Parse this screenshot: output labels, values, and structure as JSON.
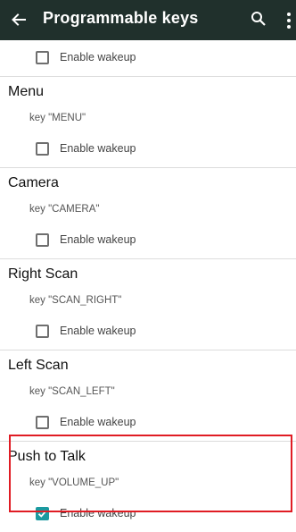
{
  "appbar": {
    "title": "Programmable keys",
    "icons": {
      "back": "arrow-back-icon",
      "search": "search-icon",
      "more": "more-vert-icon"
    }
  },
  "top_wakeup": {
    "label": "Enable wakeup",
    "checked": false
  },
  "sections": [
    {
      "title": "Menu",
      "key": "key \"MENU\"",
      "wakeup_label": "Enable wakeup",
      "checked": false
    },
    {
      "title": "Camera",
      "key": "key \"CAMERA\"",
      "wakeup_label": "Enable wakeup",
      "checked": false
    },
    {
      "title": "Right Scan",
      "key": "key \"SCAN_RIGHT\"",
      "wakeup_label": "Enable wakeup",
      "checked": false
    },
    {
      "title": "Left Scan",
      "key": "key \"SCAN_LEFT\"",
      "wakeup_label": "Enable wakeup",
      "checked": false
    },
    {
      "title": "Push to Talk",
      "key": "key \"VOLUME_UP\"",
      "wakeup_label": "Enable wakeup",
      "checked": true
    }
  ],
  "colors": {
    "appbar": "#20302c",
    "accent": "#1b9aa0",
    "highlight": "#e01c24"
  }
}
